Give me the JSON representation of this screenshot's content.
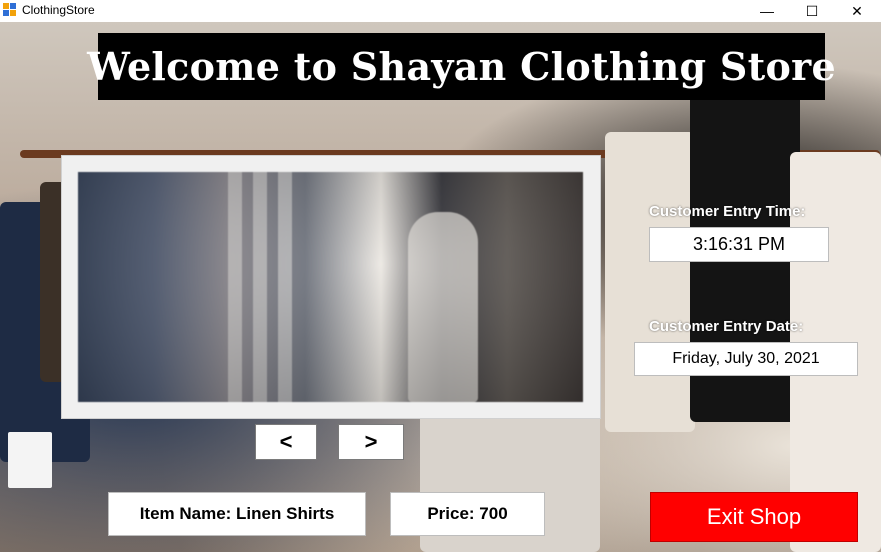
{
  "window": {
    "title": "ClothingStore",
    "minimize_glyph": "—",
    "maximize_glyph": "☐",
    "close_glyph": "✕"
  },
  "banner": {
    "text": "Welcome to Shayan Clothing Store"
  },
  "nav": {
    "prev_label": "<",
    "next_label": ">"
  },
  "entry_time": {
    "label": "Customer Entry Time:",
    "value": "3:16:31 PM"
  },
  "entry_date": {
    "label": "Customer Entry Date:",
    "value": "Friday, July 30, 2021"
  },
  "item": {
    "name": "Item Name: Linen Shirts",
    "price": "Price: 700"
  },
  "exit": {
    "label": "Exit Shop"
  },
  "colors": {
    "exit_button": "#ff0000",
    "banner_bg": "#000000"
  }
}
